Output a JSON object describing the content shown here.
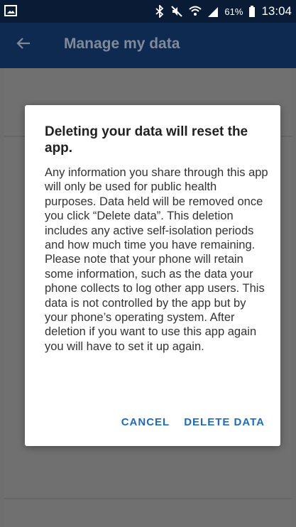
{
  "status_bar": {
    "time": "13:04",
    "battery_percent": "61%",
    "icons": [
      "image-notification-icon",
      "bluetooth-icon",
      "mute-icon",
      "wifi-icon",
      "signal-icon",
      "battery-icon"
    ]
  },
  "app_bar": {
    "title": "Manage my data",
    "back_icon": "arrow-left-icon"
  },
  "dialog": {
    "title": "Deleting your data will reset the app.",
    "body": "Any information you share through this app will only be used for public health purposes. Data held will be removed once you click “Delete data”. This deletion includes any active self-isolation periods and how much time you have remaining. Please note that your phone will retain some information, such as the data your phone collects to log other app users. This data is not controlled by the app but by your phone’s operating system. After deletion if you want to use this app again you will have to set it up again.",
    "cancel_label": "CANCEL",
    "delete_label": "DELETE DATA"
  },
  "colors": {
    "status_bar_bg": "#0a1c35",
    "app_bar_bg": "#0e2a50",
    "accent": "#1e6bb8",
    "scrim": "#707070"
  }
}
